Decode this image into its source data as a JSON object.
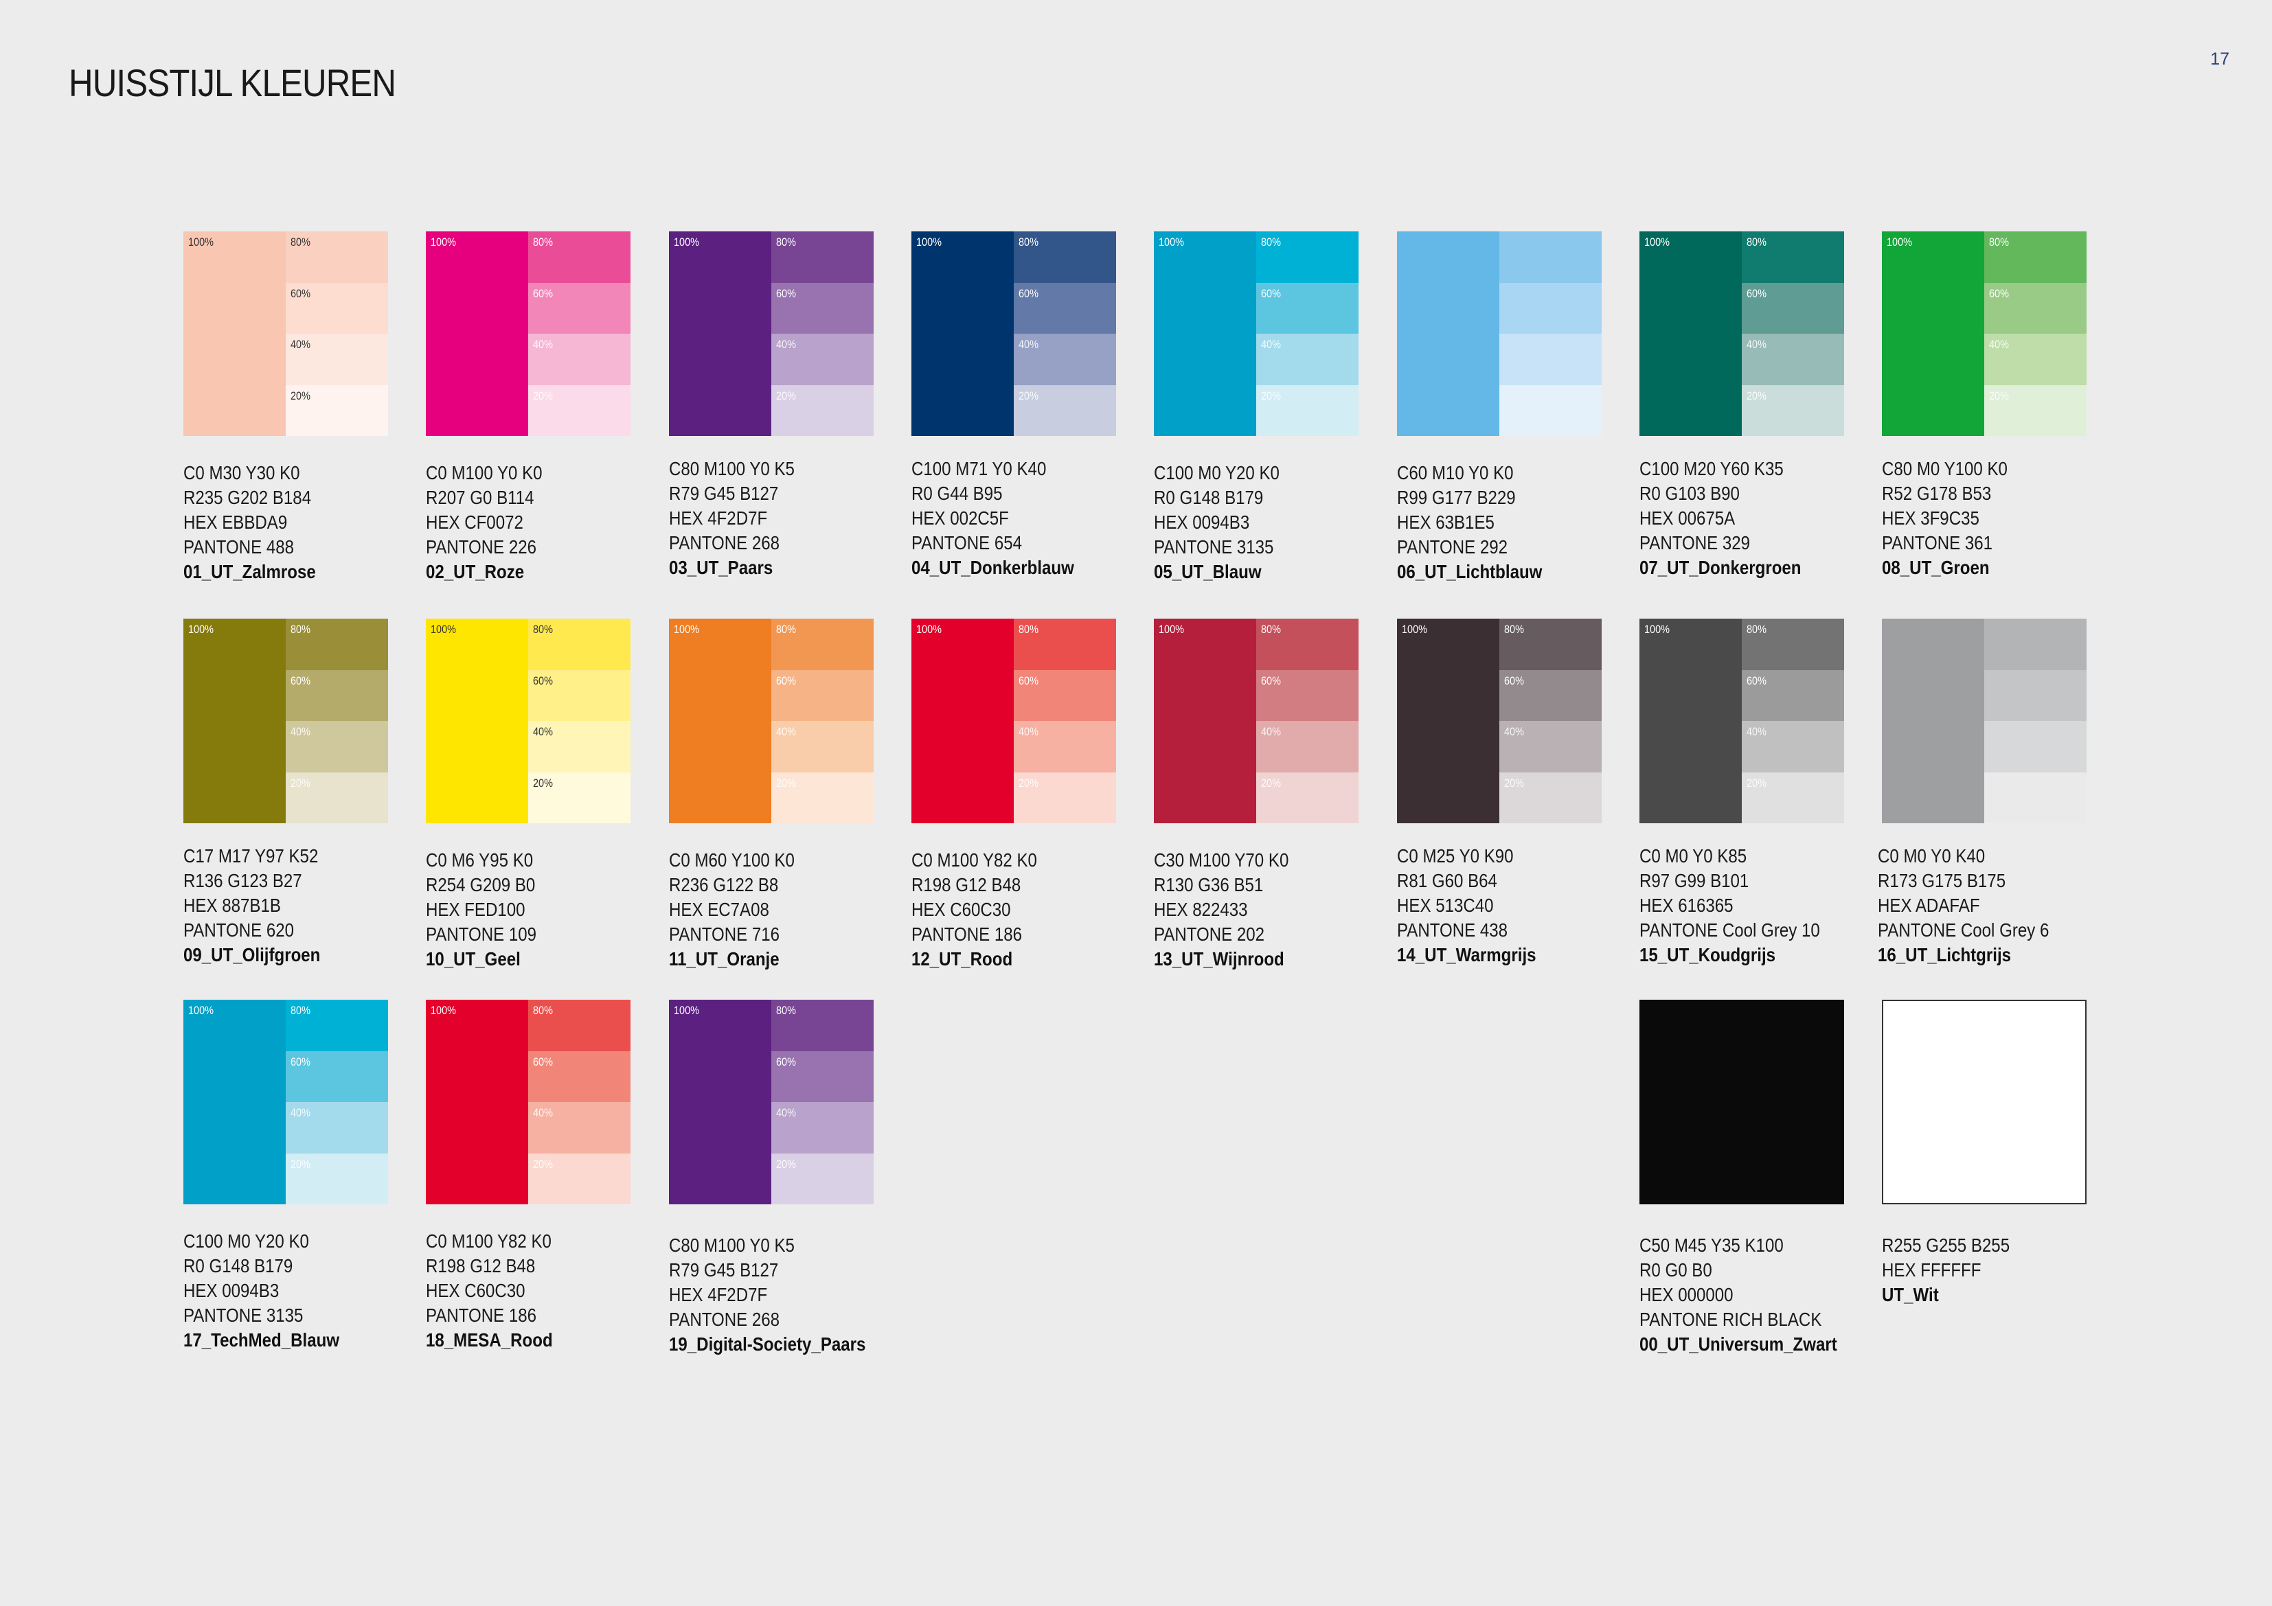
{
  "page": {
    "title": "HUISSTIJL KLEUREN",
    "number": "17"
  },
  "tint_labels": {
    "main": "100%",
    "t80": "80%",
    "t60": "60%",
    "t40": "40%",
    "t20": "20%"
  },
  "colors": [
    {
      "name": "01_UT_Zalmrose",
      "cmyk": "C0 M30 Y30 K0",
      "rgb": "R235 G202 B184",
      "hex": "HEX EBBDA9",
      "pantone": "PANTONE 488",
      "swatch": {
        "main": "#f9c6b2",
        "t80": "#fad1c0",
        "t60": "#fcddd0",
        "t40": "#fde8e0",
        "t20": "#fef3ef"
      }
    },
    {
      "name": "02_UT_Roze",
      "cmyk": "C0 M100 Y0 K0",
      "rgb": "R207 G0 B114",
      "hex": "HEX CF0072",
      "pantone": "PANTONE 226",
      "swatch": {
        "main": "#e6007e",
        "t80": "#eb4c98",
        "t60": "#f286b9",
        "t40": "#f5b7d4",
        "t20": "#fbdbe9"
      }
    },
    {
      "name": "03_UT_Paars",
      "cmyk": "C80 M100 Y0 K5",
      "rgb": "R79 G45 B127",
      "hex": "HEX 4F2D7F",
      "pantone": "PANTONE 268",
      "swatch": {
        "main": "#5b2080",
        "t80": "#774593",
        "t60": "#9873b0",
        "t40": "#b9a2cb",
        "t20": "#dad0e6"
      }
    },
    {
      "name": "04_UT_Donkerblauw",
      "cmyk": "C100 M71 Y0 K40",
      "rgb": "R0 G44 B95",
      "hex": "HEX 002C5F",
      "pantone": "PANTONE 654",
      "swatch": {
        "main": "#00346c",
        "t80": "#33568a",
        "t60": "#6379a8",
        "t40": "#96a1c5",
        "t20": "#c8cde0"
      }
    },
    {
      "name": "05_UT_Blauw",
      "cmyk": "C100 M0 Y20 K0",
      "rgb": "R0 G148 B179",
      "hex": "HEX 0094B3",
      "pantone": "PANTONE 3135",
      "swatch": {
        "main": "#00a0c8",
        "t80": "#00b1d6",
        "t60": "#5cc6e0",
        "t40": "#a3dbec",
        "t20": "#d3edf5"
      }
    },
    {
      "name": "06_UT_Lichtblauw",
      "cmyk": "C60 M10 Y0 K0",
      "rgb": "R99 G177 B229",
      "hex": "HEX 63B1E5",
      "pantone": "PANTONE 292",
      "swatch": {
        "main": "#64b8e8",
        "t80": "#8ac8ee",
        "t60": "#a9d6f3",
        "t40": "#c8e3f7",
        "t20": "#e4f1fb"
      }
    },
    {
      "name": "07_UT_Donkergroen",
      "cmyk": "C100 M20 Y60 K35",
      "rgb": "R0 G103 B90",
      "hex": "HEX 00675A",
      "pantone": "PANTONE 329",
      "swatch": {
        "main": "#00695c",
        "t80": "#107b6f",
        "t60": "#5e9c94",
        "t40": "#97bbb6",
        "t20": "#cadddb"
      }
    },
    {
      "name": "08_UT_Groen",
      "cmyk": "C80 M0 Y100 K0",
      "rgb": "R52 G178 B53",
      "hex": "HEX 3F9C35",
      "pantone": "PANTONE 361",
      "swatch": {
        "main": "#12a538",
        "t80": "#62b85a",
        "t60": "#99cb86",
        "t40": "#bedda9",
        "t20": "#e0efd8"
      }
    },
    {
      "name": "09_UT_Olijfgroen",
      "cmyk": "C17 M17 Y97 K52",
      "rgb": "R136 G123 B27",
      "hex": "HEX 887B1B",
      "pantone": "PANTONE 620",
      "swatch": {
        "main": "#857a0c",
        "t80": "#9a8f38",
        "t60": "#b4ab6a",
        "t40": "#cfc89d",
        "t20": "#e7e3cc"
      }
    },
    {
      "name": "10_UT_Geel",
      "cmyk": "C0 M6 Y95 K0",
      "rgb": "R254 G209 B0",
      "hex": "HEX FED100",
      "pantone": "PANTONE 109",
      "swatch": {
        "main": "#ffe600",
        "t80": "#ffe94e",
        "t60": "#fff08a",
        "t40": "#fff5b7",
        "t20": "#fffadc"
      }
    },
    {
      "name": "11_UT_Oranje",
      "cmyk": "C0 M60 Y100 K0",
      "rgb": "R236 G122 B8",
      "hex": "HEX EC7A08",
      "pantone": "PANTONE 716",
      "swatch": {
        "main": "#ef7d22",
        "t80": "#f29752",
        "t60": "#f6b385",
        "t40": "#f9cdaa",
        "t20": "#fde6d6"
      }
    },
    {
      "name": "12_UT_Rood",
      "cmyk": "C0 M100 Y82 K0",
      "rgb": "R198 G12 B48",
      "hex": "HEX C60C30",
      "pantone": "PANTONE 186",
      "swatch": {
        "main": "#e3002a",
        "t80": "#ea4f4e",
        "t60": "#f18578",
        "t40": "#f6b1a3",
        "t20": "#fbd9d1"
      }
    },
    {
      "name": "13_UT_Wijnrood",
      "cmyk": "C30 M100 Y70 K0",
      "rgb": "R130 G36 B51",
      "hex": "HEX 822433",
      "pantone": "PANTONE 202",
      "swatch": {
        "main": "#b51f3c",
        "t80": "#c4505c",
        "t60": "#d27d81",
        "t40": "#e1aaab",
        "t20": "#f0d4d4"
      }
    },
    {
      "name": "14_UT_Warmgrijs",
      "cmyk": "C0 M25 Y0 K90",
      "rgb": "R81 G60 B64",
      "hex": "HEX 513C40",
      "pantone": "PANTONE 438",
      "swatch": {
        "main": "#3c2f33",
        "t80": "#665c60",
        "t60": "#938a8e",
        "t40": "#b9b1b4",
        "t20": "#dcd8d9"
      }
    },
    {
      "name": "15_UT_Koudgrijs",
      "cmyk": "C0 M0 Y0 K85",
      "rgb": "R97 G99 B101",
      "hex": "HEX 616365",
      "pantone": "PANTONE Cool Grey 10",
      "swatch": {
        "main": "#4a4a4a",
        "t80": "#737373",
        "t60": "#9b9b9b",
        "t40": "#c0c0c0",
        "t20": "#e0e0e0"
      }
    },
    {
      "name": "16_UT_Lichtgrijs",
      "cmyk": "C0 M0 Y0 K40",
      "rgb": "R173 G175 B175",
      "hex": "HEX ADAFAF",
      "pantone": "PANTONE Cool Grey 6",
      "swatch": {
        "main": "#9d9fa1",
        "t80": "#b2b4b5",
        "t60": "#c3c5c6",
        "t40": "#d7d8d9",
        "t20": "#eaeaeb"
      }
    },
    {
      "name": "17_TechMed_Blauw",
      "cmyk": "C100 M0 Y20 K0",
      "rgb": "R0 G148 B179",
      "hex": "HEX 0094B3",
      "pantone": "PANTONE 3135",
      "swatch": {
        "main": "#00a0c8",
        "t80": "#00b1d6",
        "t60": "#5cc6e0",
        "t40": "#a3dbec",
        "t20": "#d3edf5"
      }
    },
    {
      "name": "18_MESA_Rood",
      "cmyk": "C0 M100 Y82 K0",
      "rgb": "R198 G12 B48",
      "hex": "HEX C60C30",
      "pantone": "PANTONE 186",
      "swatch": {
        "main": "#e3002a",
        "t80": "#ea4f4e",
        "t60": "#f18578",
        "t40": "#f6b1a3",
        "t20": "#fbd9d1"
      }
    },
    {
      "name": "19_Digital-Society_Paars",
      "cmyk": "C80 M100 Y0 K5",
      "rgb": "R79 G45 B127",
      "hex": "HEX 4F2D7F",
      "pantone": "PANTONE 268",
      "swatch": {
        "main": "#5b2080",
        "t80": "#774593",
        "t60": "#9873b0",
        "t40": "#b9a2cb",
        "t20": "#dad0e6"
      }
    },
    {
      "name": "00_UT_Universum_Zwart",
      "cmyk": "C50 M45 Y35 K100",
      "rgb": "R0 G0 B0",
      "hex": "HEX 000000",
      "pantone": "PANTONE RICH BLACK",
      "swatch": {
        "main": "#0a0a0a"
      }
    },
    {
      "name": "UT_Wit",
      "rgb": "R255 G255 B255",
      "hex": "HEX FFFFFF",
      "swatch": {
        "main": "#ffffff"
      }
    }
  ]
}
